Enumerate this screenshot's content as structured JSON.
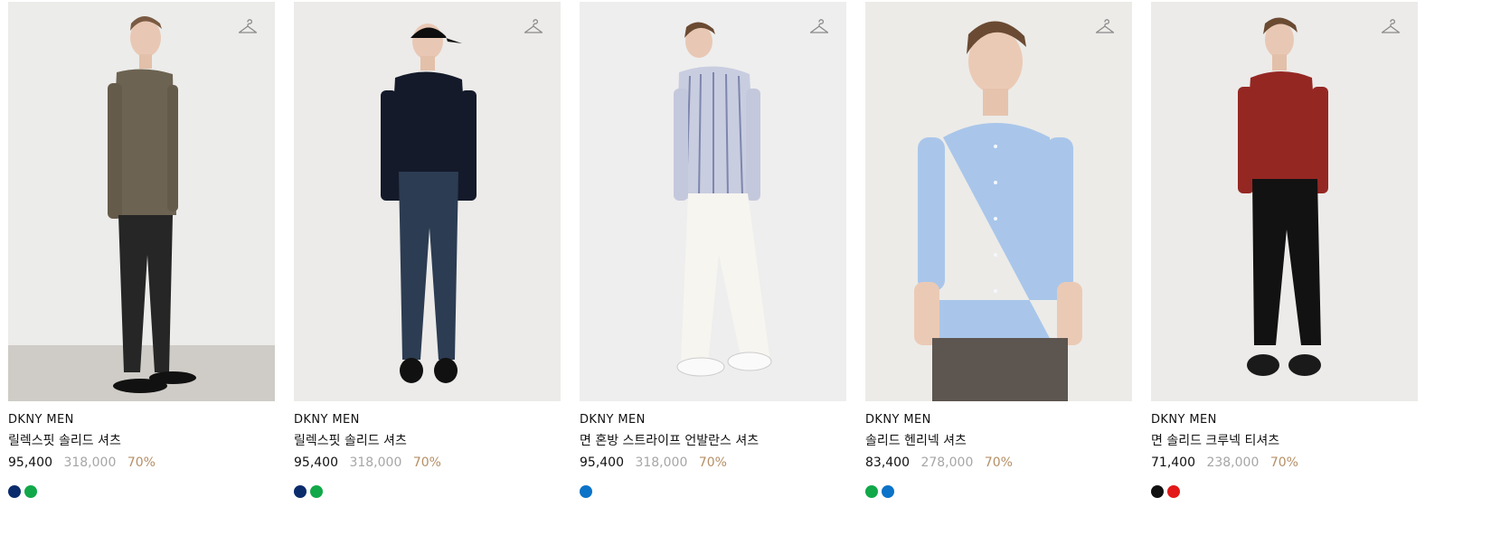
{
  "products": [
    {
      "brand": "DKNY MEN",
      "name": "릴렉스핏 솔리드 셔츠",
      "price_sale": "95,400",
      "price_original": "318,000",
      "discount": "70%",
      "colors": [
        "#0b2c6c",
        "#11a84a"
      ]
    },
    {
      "brand": "DKNY MEN",
      "name": "릴렉스핏 솔리드 셔츠",
      "price_sale": "95,400",
      "price_original": "318,000",
      "discount": "70%",
      "colors": [
        "#0b2c6c",
        "#11a84a"
      ]
    },
    {
      "brand": "DKNY MEN",
      "name": "면 혼방 스트라이프 언발란스 셔츠",
      "price_sale": "95,400",
      "price_original": "318,000",
      "discount": "70%",
      "colors": [
        "#0b73c8"
      ]
    },
    {
      "brand": "DKNY MEN",
      "name": "솔리드 헨리넥 셔츠",
      "price_sale": "83,400",
      "price_original": "278,000",
      "discount": "70%",
      "colors": [
        "#11a84a",
        "#0b73c8"
      ]
    },
    {
      "brand": "DKNY MEN",
      "name": "면 솔리드 크루넥 티셔츠",
      "price_sale": "71,400",
      "price_original": "238,000",
      "discount": "70%",
      "colors": [
        "#111111",
        "#e31919"
      ]
    }
  ],
  "icons": {
    "wishlist": "hanger-icon"
  }
}
